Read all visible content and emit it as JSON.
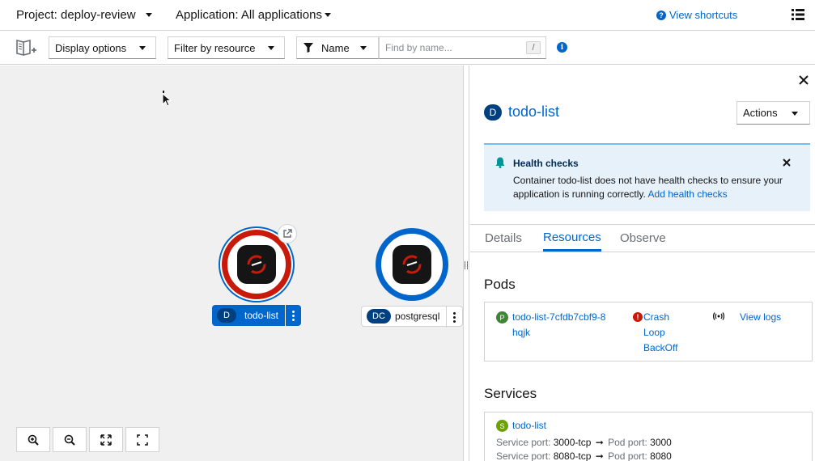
{
  "topbar": {
    "project": "Project: deploy-review",
    "application": "Application: All applications",
    "shortcuts": "View shortcuts",
    "list_icon": "list-view-icon"
  },
  "toolbar": {
    "display_options": "Display options",
    "filter_by_resource": "Filter by resource",
    "filter_type": "Name",
    "search_placeholder": "Find by name...",
    "slash": "/"
  },
  "topology": {
    "nodes": [
      {
        "badge": "D",
        "name": "todo-list",
        "status": "error",
        "selected": true
      },
      {
        "badge": "DC",
        "name": "postgresql",
        "status": "running",
        "selected": false
      }
    ]
  },
  "panel": {
    "badge": "D",
    "title": "todo-list",
    "actions": "Actions",
    "alert": {
      "title": "Health checks",
      "text": "Container todo-list does not have health checks to ensure your application is running correctly.",
      "link": "Add health checks"
    },
    "tabs": [
      "Details",
      "Resources",
      "Observe"
    ],
    "active_tab": "Resources",
    "pods_title": "Pods",
    "pod": {
      "badge": "P",
      "name": "todo-list-7cfdb7cbf9-8hqjk",
      "status": "Crash Loop BackOff",
      "logs": "View logs"
    },
    "services_title": "Services",
    "service": {
      "badge": "S",
      "name": "todo-list",
      "service_port_label": "Service port:",
      "pod_port_label": "Pod port:",
      "ports": [
        {
          "service_port": "3000-tcp",
          "pod_port": "3000"
        },
        {
          "service_port": "8080-tcp",
          "pod_port": "8080"
        }
      ]
    }
  },
  "colors": {
    "accent": "#0066cc",
    "error": "#c9190b",
    "selected_pill": "#0066cc",
    "badge_dark": "#004080",
    "pod_badge": "#3e8635",
    "service_badge": "#6ca100"
  }
}
